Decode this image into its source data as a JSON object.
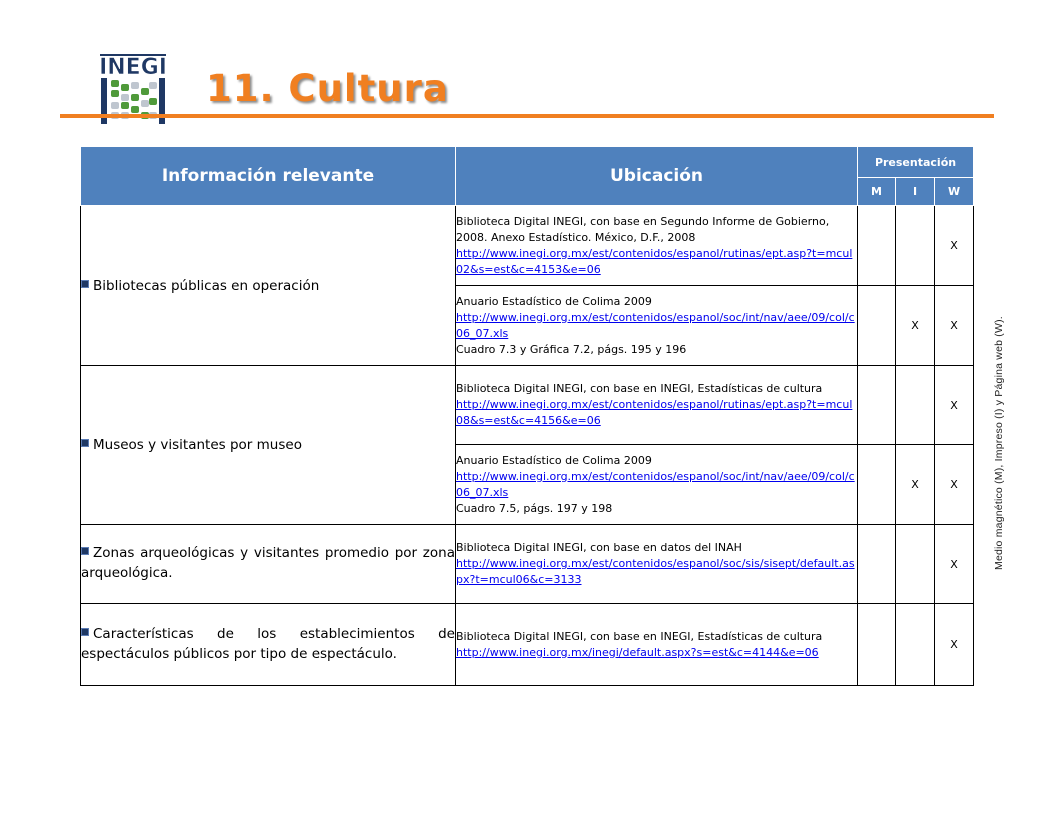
{
  "header": {
    "logo_text": "INEGI",
    "title": "11. Cultura",
    "accent_color": "#f07f21",
    "header_blue": "#4f81bd"
  },
  "table": {
    "col_info": "Información relevante",
    "col_location": "Ubicación",
    "col_presentation": "Presentación",
    "col_m": "M",
    "col_i": "I",
    "col_w": "W",
    "groups": [
      {
        "topic": "Bibliotecas públicas en operación",
        "rows": [
          {
            "text": "Biblioteca Digital INEGI, con base en Segundo Informe de Gobierno, 2008. Anexo Estadístico. México, D.F., 2008",
            "link": "http://www.inegi.org.mx/est/contenidos/espanol/rutinas/ept.asp?t=mcul02&s=est&c=4153&e=06",
            "extra": "",
            "m": "",
            "i": "",
            "w": "X"
          },
          {
            "text": "Anuario Estadístico de Colima 2009",
            "link": "http://www.inegi.org.mx/est/contenidos/espanol/soc/int/nav/aee/09/col/c06_07.xls",
            "extra": "Cuadro 7.3 y Gráfica 7.2, págs. 195 y 196",
            "m": "",
            "i": "X",
            "w": "X"
          }
        ]
      },
      {
        "topic": "Museos y visitantes por museo",
        "rows": [
          {
            "text": "Biblioteca Digital INEGI, con base en INEGI, Estadísticas de cultura",
            "link": "http://www.inegi.org.mx/est/contenidos/espanol/rutinas/ept.asp?t=mcul08&s=est&c=4156&e=06",
            "extra": "",
            "m": "",
            "i": "",
            "w": "X"
          },
          {
            "text": "Anuario Estadístico de Colima 2009",
            "link": "http://www.inegi.org.mx/est/contenidos/espanol/soc/int/nav/aee/09/col/c06_07.xls",
            "extra": "Cuadro 7.5, págs. 197 y 198",
            "m": "",
            "i": "X",
            "w": "X"
          }
        ]
      },
      {
        "topic": "Zonas arqueológicas y visitantes promedio por zona arqueológica.",
        "rows": [
          {
            "text": "Biblioteca Digital INEGI, con base en datos del INAH",
            "link": "http://www.inegi.org.mx/est/contenidos/espanol/soc/sis/sisept/default.aspx?t=mcul06&c=3133",
            "extra": "",
            "m": "",
            "i": "",
            "w": "X"
          }
        ]
      },
      {
        "topic": "Características de los establecimientos de espectáculos públicos por tipo de espectáculo.",
        "rows": [
          {
            "text": "Biblioteca Digital INEGI, con base en INEGI, Estadísticas de cultura",
            "link": "http://www.inegi.org.mx/inegi/default.aspx?s=est&c=4144&e=06",
            "extra": "",
            "m": "",
            "i": "",
            "w": "X"
          }
        ]
      }
    ]
  },
  "side_note": "Medio magnético (M), Impreso (I) y Página web (W)."
}
